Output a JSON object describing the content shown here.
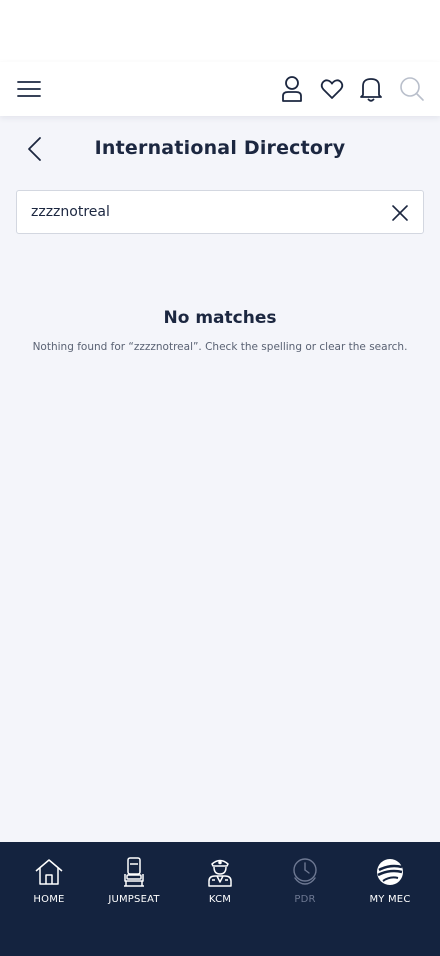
{
  "header": {
    "icons": [
      "menu-icon",
      "profile-icon",
      "heart-icon",
      "bell-icon",
      "search-icon"
    ]
  },
  "page": {
    "title": "International Directory"
  },
  "search": {
    "value": "zzzznotreal"
  },
  "empty_state": {
    "title": "No matches",
    "message": "Nothing found for “zzzznotreal”. Check the spelling or clear the search."
  },
  "bottom_nav": {
    "items": [
      {
        "label": "HOME",
        "icon": "home-icon",
        "enabled": true
      },
      {
        "label": "JUMPSEAT",
        "icon": "seat-icon",
        "enabled": true
      },
      {
        "label": "KCM",
        "icon": "pilot-icon",
        "enabled": true
      },
      {
        "label": "PDR",
        "icon": "clock-icon",
        "enabled": false
      },
      {
        "label": "MY MEC",
        "icon": "mec-globe-icon",
        "enabled": true
      }
    ]
  },
  "colors": {
    "navy": "#14233f",
    "text": "#1c2740",
    "background": "#f4f5fa",
    "disabled": "#6d7892"
  }
}
